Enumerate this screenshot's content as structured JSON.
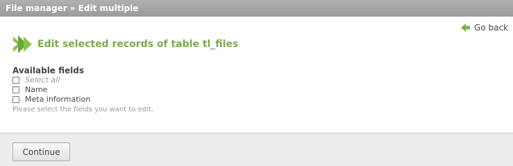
{
  "header": {
    "breadcrumb": "File manager » Edit multiple"
  },
  "navigation": {
    "go_back_label": "Go back",
    "go_back_icon": "back-arrow-icon"
  },
  "main": {
    "title": "Edit selected records of table tl_files",
    "title_icon": "double-chevron-icon",
    "accent_color": "#77ac45"
  },
  "fields": {
    "legend": "Available fields",
    "options": [
      {
        "label": "Select all",
        "checked": false
      },
      {
        "label": "Name",
        "checked": false
      },
      {
        "label": "Meta information",
        "checked": false
      }
    ],
    "tip": "Please select the fields you want to edit."
  },
  "footer": {
    "continue_label": "Continue"
  }
}
